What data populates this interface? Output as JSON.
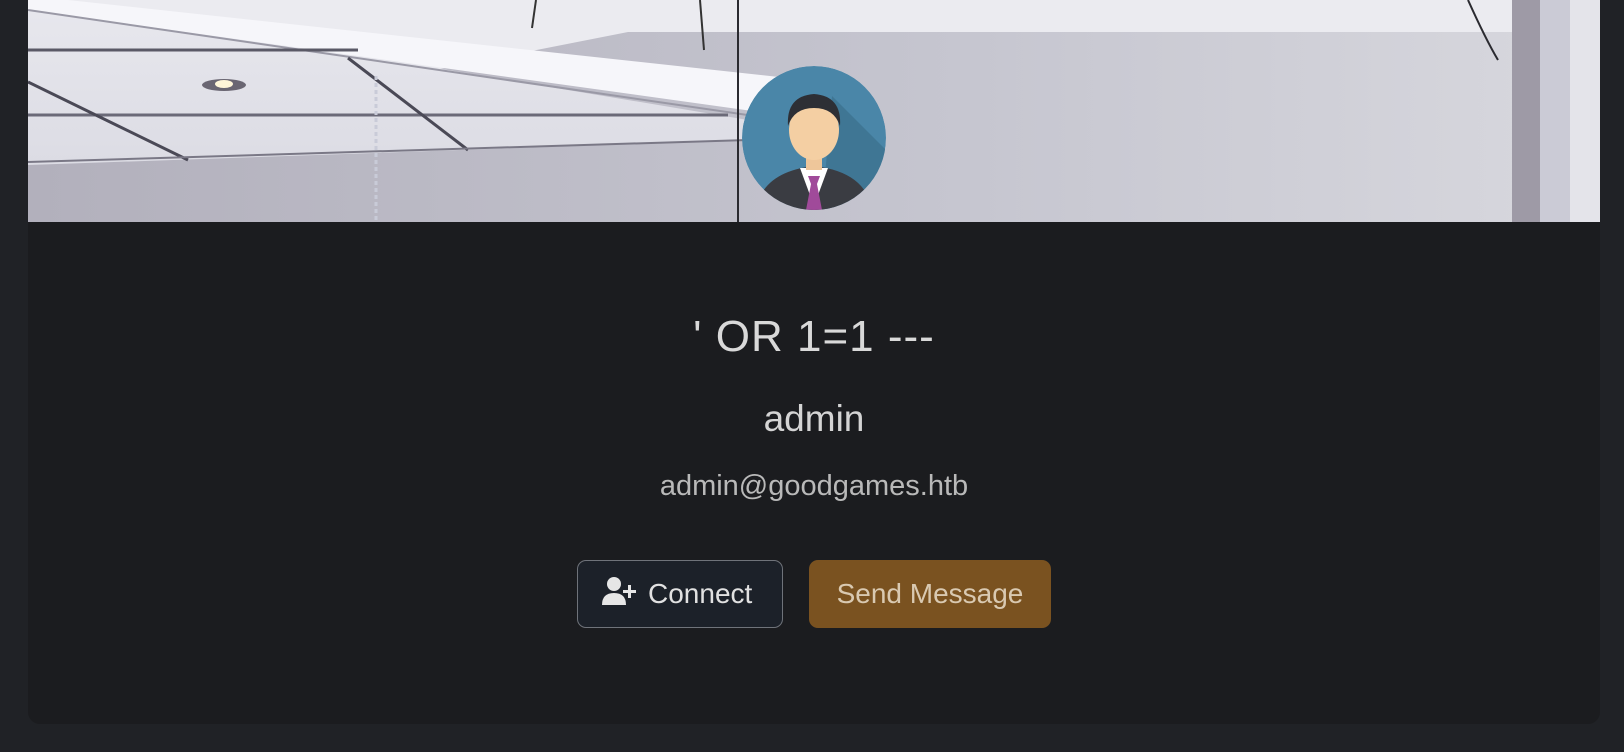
{
  "profile": {
    "display_name": "' OR 1=1 ---",
    "username": "admin",
    "email": "admin@goodgames.htb"
  },
  "actions": {
    "connect_label": "Connect",
    "connect_icon": "user-plus-icon",
    "send_message_label": "Send Message"
  },
  "colors": {
    "page_background": "#202226",
    "card_background": "#1b1c1f",
    "connect_button": "#1c2129",
    "send_message_button": "#7a5220"
  }
}
